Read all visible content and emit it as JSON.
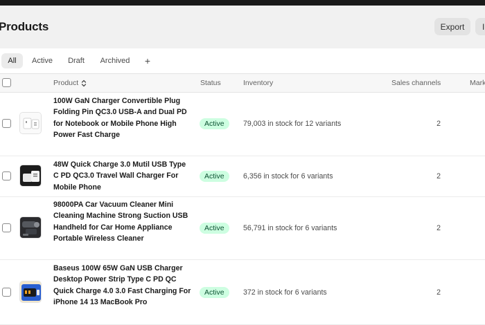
{
  "header": {
    "title": "Products",
    "export_label": "Export",
    "import_label": "Im"
  },
  "tabs": [
    {
      "label": "All",
      "active": true
    },
    {
      "label": "Active"
    },
    {
      "label": "Draft"
    },
    {
      "label": "Archived"
    },
    {
      "label": "+"
    }
  ],
  "table": {
    "columns": [
      "Product",
      "Status",
      "Inventory",
      "Sales channels",
      "Mark"
    ],
    "rows": [
      {
        "name": "100W GaN Charger Convertible Plug Folding Pin QC3.0 USB-A and Dual PD for Notebook or Mobile Phone High Power Fast Charge",
        "status": "Active",
        "inventory": "79,003 in stock for 12 variants",
        "sales_channels": "2",
        "thumb_icon": "white-charger-image"
      },
      {
        "name": "48W Quick Charge 3.0 Mutil USB Type C PD QC3.0 Travel Wall Charger For Mobile Phone",
        "status": "Active",
        "inventory": "6,356 in stock for 6 variants",
        "sales_channels": "2",
        "thumb_icon": "wall-charger-image"
      },
      {
        "name": "98000PA Car Vacuum Cleaner Mini Cleaning Machine Strong Suction USB Handheld for Car Home Appliance Portable Wireless Cleaner",
        "status": "Active",
        "inventory": "56,791 in stock for 6 variants",
        "sales_channels": "2",
        "thumb_icon": "car-vacuum-image"
      },
      {
        "name": "Baseus 100W 65W GaN USB Charger Desktop Power Strip Type C PD QC Quick Charge 4.0 3.0 Fast Charging For iPhone 14 13 MacBook Pro",
        "status": "Active",
        "inventory": "372 in stock for 6 variants",
        "sales_channels": "2",
        "thumb_icon": "power-strip-image"
      }
    ]
  },
  "colors": {
    "badge_bg": "#cdfee1",
    "badge_text": "#0c5132",
    "page_bg": "#f1f1f1"
  }
}
